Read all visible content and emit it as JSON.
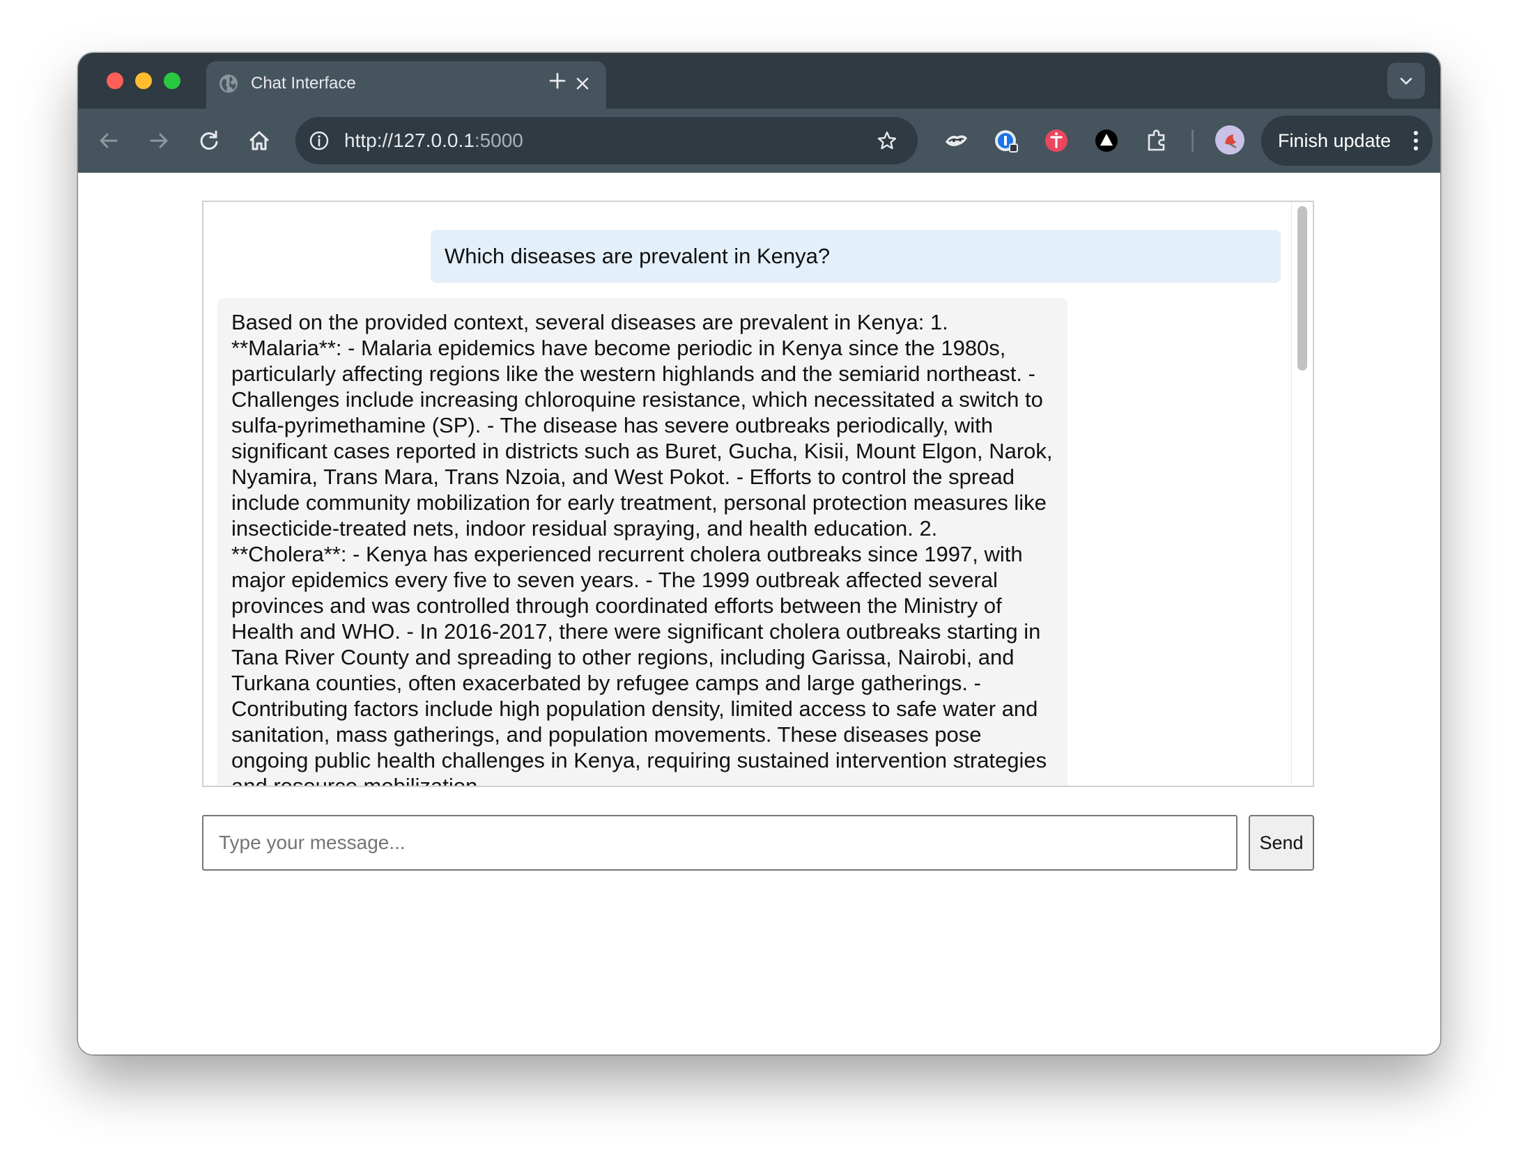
{
  "browser": {
    "tab_title": "Chat Interface",
    "url_host": "http://127.0.0.1",
    "url_port": ":5000",
    "finish_update_label": "Finish update",
    "colors": {
      "frame": "#2f3a42",
      "toolbar": "#46545d",
      "traffic_red": "#ff5f57",
      "traffic_yellow": "#febc2e",
      "traffic_green": "#28c840"
    },
    "icons": [
      "globe-icon",
      "close-icon",
      "plus-icon",
      "chevron-down-icon",
      "back-arrow-icon",
      "forward-arrow-icon",
      "reload-icon",
      "home-icon",
      "info-icon",
      "star-icon",
      "extension-puzzle-icon",
      "kebab-menu-icon"
    ]
  },
  "chat": {
    "messages": [
      {
        "role": "user",
        "text": "Which diseases are prevalent in Kenya?"
      },
      {
        "role": "bot",
        "text": "Based on the provided context, several diseases are prevalent in Kenya: 1. **Malaria**: - Malaria epidemics have become periodic in Kenya since the 1980s, particularly affecting regions like the western highlands and the semiarid northeast. - Challenges include increasing chloroquine resistance, which necessitated a switch to sulfa-pyrimethamine (SP). - The disease has severe outbreaks periodically, with significant cases reported in districts such as Buret, Gucha, Kisii, Mount Elgon, Narok, Nyamira, Trans Mara, Trans Nzoia, and West Pokot. - Efforts to control the spread include community mobilization for early treatment, personal protection measures like insecticide-treated nets, indoor residual spraying, and health education. 2. **Cholera**: - Kenya has experienced recurrent cholera outbreaks since 1997, with major epidemics every five to seven years. - The 1999 outbreak affected several provinces and was controlled through coordinated efforts between the Ministry of Health and WHO. - In 2016-2017, there were significant cholera outbreaks starting in Tana River County and spreading to other regions, including Garissa, Nairobi, and Turkana counties, often exacerbated by refugee camps and large gatherings. - Contributing factors include high population density, limited access to safe water and sanitation, mass gatherings, and population movements. These diseases pose ongoing public health challenges in Kenya, requiring sustained intervention strategies and resource mobilization."
      }
    ],
    "input": {
      "placeholder": "Type your message...",
      "value": ""
    },
    "send_label": "Send",
    "colors": {
      "user_bubble": "#e3eff9",
      "bot_bubble": "#f4f4f4"
    }
  }
}
